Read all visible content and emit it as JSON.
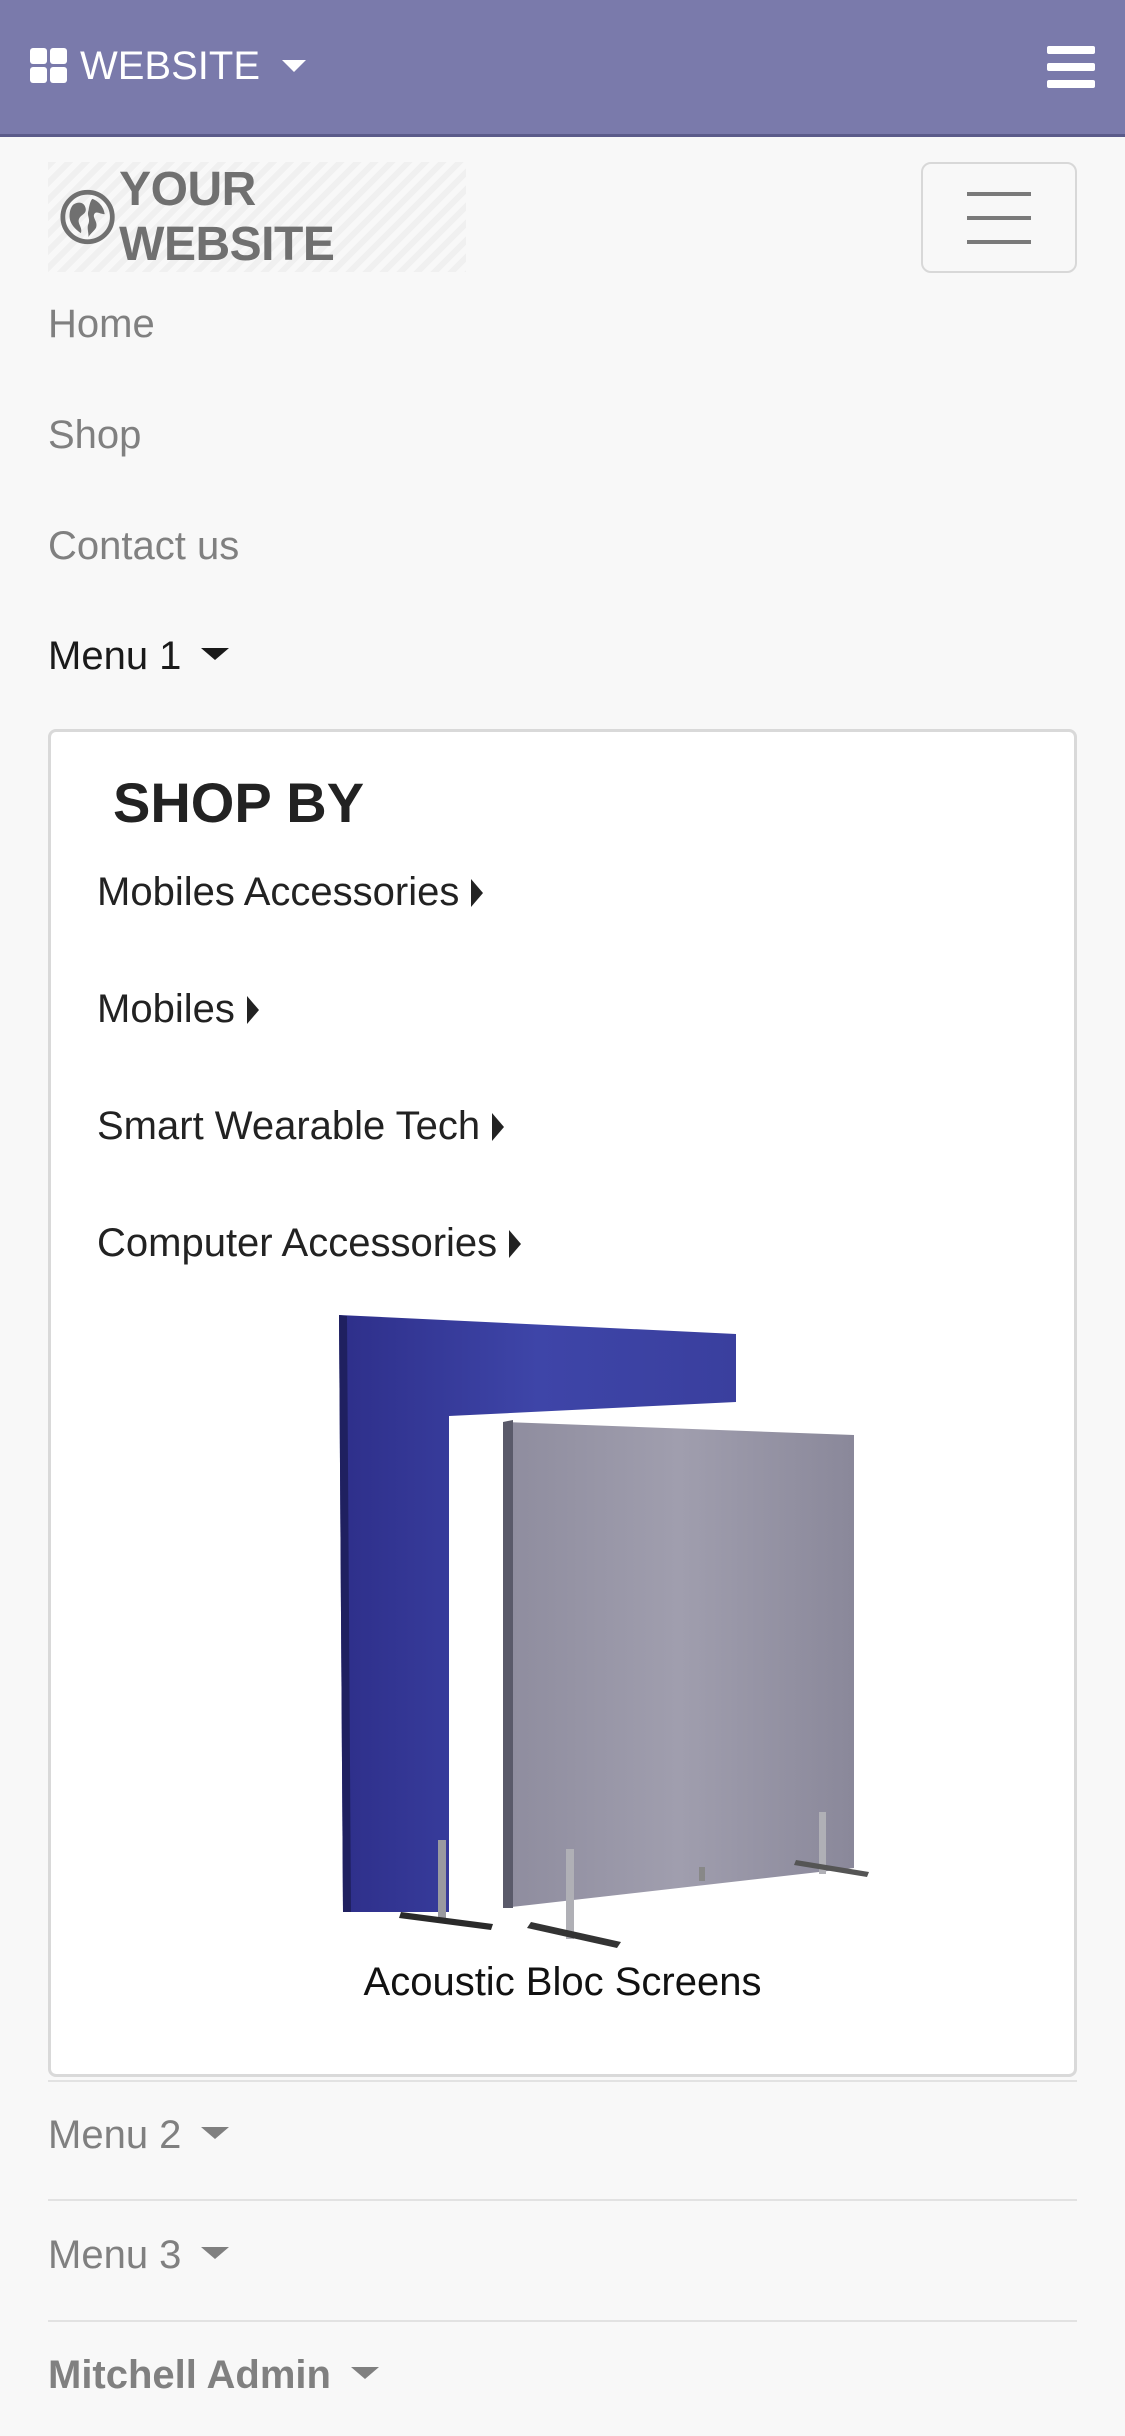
{
  "topbar": {
    "website_label": "WEBSITE",
    "bg_color": "#7a7aab"
  },
  "brand": {
    "name": "YOUR WEBSITE"
  },
  "nav": {
    "items": [
      {
        "label": "Home"
      },
      {
        "label": "Shop"
      },
      {
        "label": "Contact us"
      },
      {
        "label": "Menu 1"
      },
      {
        "label": "Menu 2"
      },
      {
        "label": "Menu 3"
      }
    ],
    "user": "Mitchell Admin"
  },
  "mega_menu": {
    "heading": "SHOP BY",
    "categories": [
      {
        "label": "Mobiles Accessories"
      },
      {
        "label": "Mobiles"
      },
      {
        "label": "Smart Wearable Tech"
      },
      {
        "label": "Computer Accessories"
      }
    ],
    "product": {
      "name": "Acoustic Bloc Screens"
    }
  }
}
